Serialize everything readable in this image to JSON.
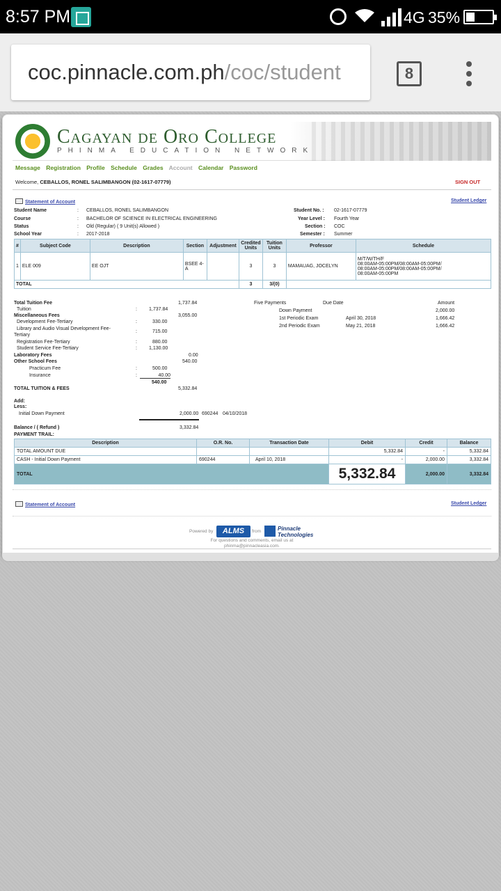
{
  "status_bar": {
    "time": "8:57 PM",
    "network": "4G",
    "battery": "35%"
  },
  "browser": {
    "url_host": "coc.pinnacle.com.ph",
    "url_path": "/coc/student",
    "tab_count": "8"
  },
  "banner": {
    "college": "Cagayan de Oro College",
    "network": "PHINMA EDUCATION NETWORK"
  },
  "nav": {
    "items": [
      "Message",
      "Registration",
      "Profile",
      "Schedule",
      "Grades",
      "Account",
      "Calendar",
      "Password"
    ]
  },
  "welcome": {
    "prefix": "Welcome,",
    "name": "CEBALLOS, RONEL SALIMBANGON (02-1617-07779)",
    "signout": "SIGN OUT"
  },
  "links": {
    "statement": "Statement of Account",
    "ledger": "Student Ledger"
  },
  "student": {
    "name_label": "Student Name",
    "name": "CEBALLOS, RONEL SALIMBANGON",
    "course_label": "Course",
    "course": "BACHELOR OF SCIENCE IN ELECTRICAL ENGINEERING",
    "status_label": "Status",
    "status": "Old (Regular) ( 9 Unit(s) Allowed )",
    "sy_label": "School Year",
    "sy": "2017-2018",
    "no_label": "Student No. :",
    "no": "02-1617-07779",
    "level_label": "Year Level :",
    "level": "Fourth Year",
    "section_label": "Section :",
    "section": "COC",
    "semester_label": "Semester :",
    "semester": "Summer",
    "colon": ":"
  },
  "subjects": {
    "headers": [
      "#",
      "Subject Code",
      "Description",
      "Section",
      "Adjustment",
      "Credited Units",
      "Tuition Units",
      "Professor",
      "Schedule"
    ],
    "rows": [
      {
        "num": "1",
        "code": "ELE 009",
        "desc": "EE OJT",
        "section": "BSEE 4-A",
        "adjustment": "",
        "credited": "3",
        "tuition": "3",
        "professor": "MAMAUAG, JOCELYN",
        "schedule_1": "M/T/W/TH/F",
        "schedule_2": "08:00AM-05:00PM/08:00AM-05:00PM/",
        "schedule_3": "08:00AM-05:00PM/08:00AM-05:00PM/",
        "schedule_4": "08:00AM-05:00PM"
      }
    ],
    "total_label": "TOTAL",
    "total_credited": "3",
    "total_tuition": "3/(0)"
  },
  "fees": {
    "total_tuition_label": "Total Tuition Fee",
    "total_tuition": "1,737.84",
    "tuition_label": "Tuition",
    "tuition": "1,737.84",
    "misc_label": "Miscellaneous Fees",
    "misc_total": "3,055.00",
    "dev_label": "Development Fee-Tertiary",
    "dev": "330.00",
    "lib_label_1": "Library and Audio Visual Development Fee-",
    "lib_label_2": "Tertiary",
    "lib": "715.00",
    "reg_label": "Registration Fee-Tertiary",
    "reg": "880.00",
    "svc_label": "Student Service Fee-Tertiary",
    "svc": "1,130.00",
    "lab_label": "Laboratory Fees",
    "lab": "0.00",
    "other_label": "Other School Fees",
    "other_total": "540.00",
    "practicum_label": "Practicum Fee",
    "practicum": "500.00",
    "insurance_label": "Insurance",
    "insurance": "40.00",
    "other_sub": "540.00",
    "total_label": "TOTAL TUITION & FEES",
    "total": "5,332.84",
    "add_label": "Add:",
    "less_label": "Less:",
    "idp_label": "Initial Down Payment",
    "idp": "2,000.00",
    "idp_or": "690244",
    "idp_date": "04/10/2018",
    "balance_label": "Balance / ( Refund )",
    "balance": "3,332.84",
    "trail_label": "PAYMENT TRAIL:",
    "colon": ":"
  },
  "payments": {
    "title": "Five Payments",
    "due_label": "Due Date",
    "amount_label": "Amount",
    "rows": [
      {
        "label": "Down Payment",
        "date": "",
        "amount": "2,000.00"
      },
      {
        "label": "1st Periodic Exam",
        "date": "April 30, 2018",
        "amount": "1,666.42"
      },
      {
        "label": "2nd Periodic Exam",
        "date": "May 21, 2018",
        "amount": "1,666.42"
      }
    ]
  },
  "trail": {
    "headers": [
      "Description",
      "O.R. No.",
      "Transaction Date",
      "Debit",
      "Credit",
      "Balance"
    ],
    "rows": [
      {
        "desc": "TOTAL AMOUNT DUE",
        "or": "",
        "date": "",
        "debit": "5,332.84",
        "credit": "-",
        "balance": "5,332.84"
      },
      {
        "desc": "CASH - Initial Down Payment",
        "or": "690244",
        "date": "April 10, 2018",
        "debit": "-",
        "credit": "2,000.00",
        "balance": "3,332.84"
      }
    ],
    "total_label": "TOTAL",
    "total_debit": "5,332.84",
    "total_credit": "2,000.00",
    "total_balance": "3,332.84"
  },
  "footer": {
    "powered": "Powered by",
    "alms": "ALMS",
    "from": "from",
    "pinnacle_1": "Pinnacle",
    "pinnacle_2": "Technologies",
    "contact_1": "For questions and comments, email us at",
    "contact_2": "phinma@pinnacleasia.com."
  }
}
